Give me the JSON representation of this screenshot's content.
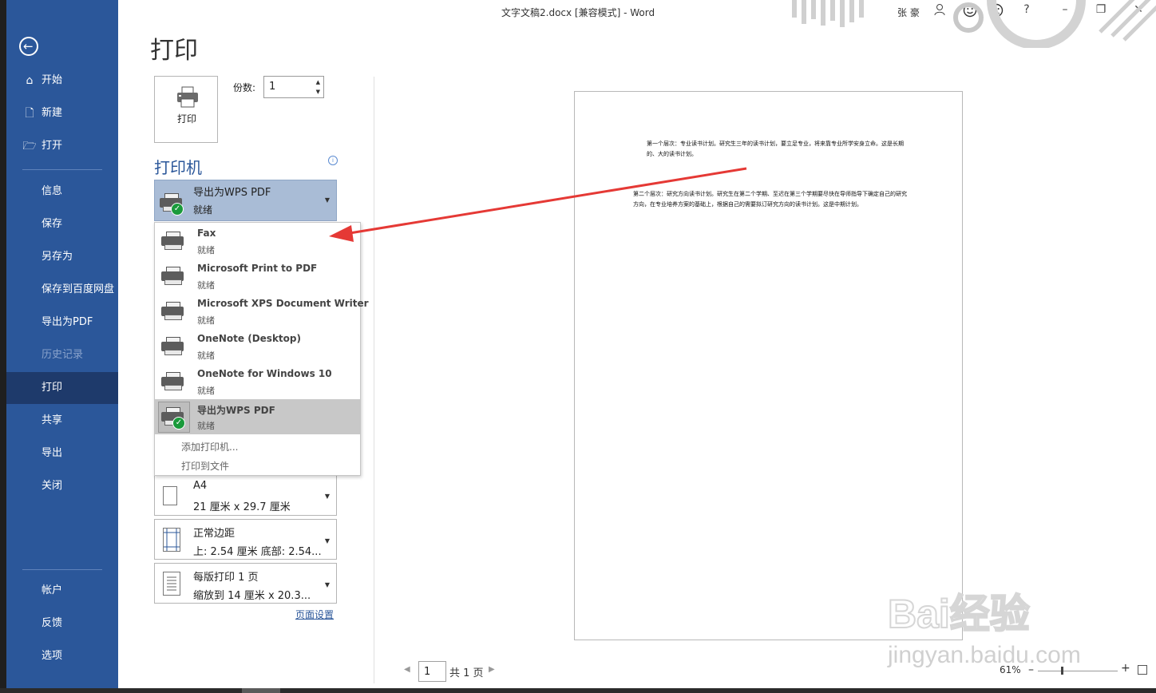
{
  "window": {
    "doc_title": "文字文稿2.docx [兼容模式]  -  Word",
    "user_name": "张 豪"
  },
  "sidebar": {
    "top_items": [
      {
        "label": "开始",
        "icon": "home-icon"
      },
      {
        "label": "新建",
        "icon": "new-document-icon"
      },
      {
        "label": "打开",
        "icon": "open-folder-icon"
      }
    ],
    "middle_items": [
      {
        "label": "信息"
      },
      {
        "label": "保存"
      },
      {
        "label": "另存为"
      },
      {
        "label": "保存到百度网盘"
      },
      {
        "label": "导出为PDF"
      },
      {
        "label": "历史记录",
        "disabled": true
      },
      {
        "label": "打印",
        "active": true
      },
      {
        "label": "共享"
      },
      {
        "label": "导出"
      },
      {
        "label": "关闭"
      }
    ],
    "bottom_items": [
      {
        "label": "帐户"
      },
      {
        "label": "反馈"
      },
      {
        "label": "选项"
      }
    ]
  },
  "print": {
    "heading": "打印",
    "print_button_label": "打印",
    "copies_label": "份数:",
    "copies_value": "1",
    "printer_heading": "打印机",
    "selected_printer": {
      "name": "导出为WPS PDF",
      "status": "就绪"
    },
    "printer_menu": [
      {
        "name": "Fax",
        "status": "就绪"
      },
      {
        "name": "Microsoft Print to PDF",
        "status": "就绪"
      },
      {
        "name": "Microsoft XPS Document Writer",
        "status": "就绪"
      },
      {
        "name": "OneNote (Desktop)",
        "status": "就绪"
      },
      {
        "name": "OneNote for Windows 10",
        "status": "就绪"
      },
      {
        "name": "导出为WPS PDF",
        "status": "就绪",
        "selected": true
      }
    ],
    "menu_links": [
      "添加打印机...",
      "打印到文件"
    ],
    "settings": [
      {
        "line1": "A4",
        "line2": "21 厘米 x 29.7 厘米"
      },
      {
        "line1": "正常边距",
        "line2": "上: 2.54 厘米 底部: 2.54..."
      },
      {
        "line1": "每版打印 1 页",
        "line2": "缩放到 14 厘米 x 20.3..."
      }
    ],
    "page_setup_link": "页面设置"
  },
  "preview": {
    "paragraph1": "第一个层次：专业读书计划。研究生三年的读书计划，要立足专业，将来靠专业所学安身立命。这是长期的、大的读书计划。",
    "paragraph2": "第二个层次：研究方向读书计划。研究生在第二个学期、至迟在第三个学期要尽快在导师指导下确定自己的研究方向，在专业培养方案的基础上，根据自己的需要拟订研究方向的读书计划。这是中期计划。"
  },
  "pager": {
    "current_page": "1",
    "total": "共 1 页",
    "zoom": "61%"
  },
  "watermark": {
    "text": "Bai经验",
    "url": "jingyan.baidu.com"
  },
  "colors": {
    "sidebar": "#2b579a",
    "sidebar_active": "#1e3a6b",
    "printer_select": "#a9bcd6",
    "arrow": "#e53935"
  }
}
